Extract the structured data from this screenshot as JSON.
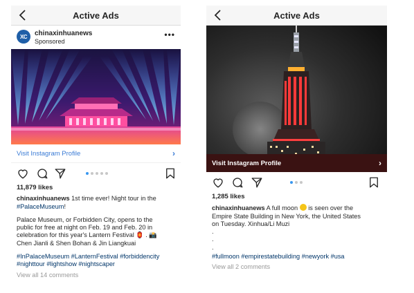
{
  "left": {
    "header_title": "Active Ads",
    "avatar_text": "XC",
    "username": "chinaxinhuanews",
    "sponsored": "Sponsored",
    "more": "•••",
    "cta_label": "Visit Instagram Profile",
    "cta_chevron": "›",
    "likes": "11,879 likes",
    "caption": {
      "username": "chinaxinhuanews",
      "line1": " 1st time ever! Night tour in the",
      "hashtag_museum": "#PalaceMuseum",
      "excl": "!",
      "para_line1": "Palace Museum, or Forbidden City, opens to the",
      "para_line2": "public for free at night on Feb. 19 and Feb. 20 in",
      "para_line3": "celebration for this year's Lantern Festival 🏮 . 📸",
      "para_line4": "Chen Jianli & Shen Bohan & Jin Liangkuai",
      "tags_line1": "#InPalaceMuseum #LanternFestival #forbiddencity",
      "tags_line2": "#nighttour #lightshow #nightscaper"
    },
    "view_all": "View all 14 comments"
  },
  "right": {
    "header_title": "Active Ads",
    "cta_label": "Visit Instagram Profile",
    "cta_chevron": "›",
    "likes": "1,285 likes",
    "caption": {
      "username": "chinaxinhuanews",
      "line1a": " A full moon ",
      "line1b": " is seen over the",
      "line2": "Empire State Building in New York, the United States",
      "line3": "on Tuesday. Xinhua/Li Muzi",
      "dot1": ".",
      "dot2": ".",
      "dot3": ".",
      "tags": "#fullmoon #empirestatebuilding #newyork #usa"
    },
    "view_all": "View all 2 comments"
  },
  "colors": {
    "link": "#3a7bd5",
    "hashtag": "#003569",
    "dot_active": "#3897f0",
    "right_cta_bg": "#3a1212"
  }
}
